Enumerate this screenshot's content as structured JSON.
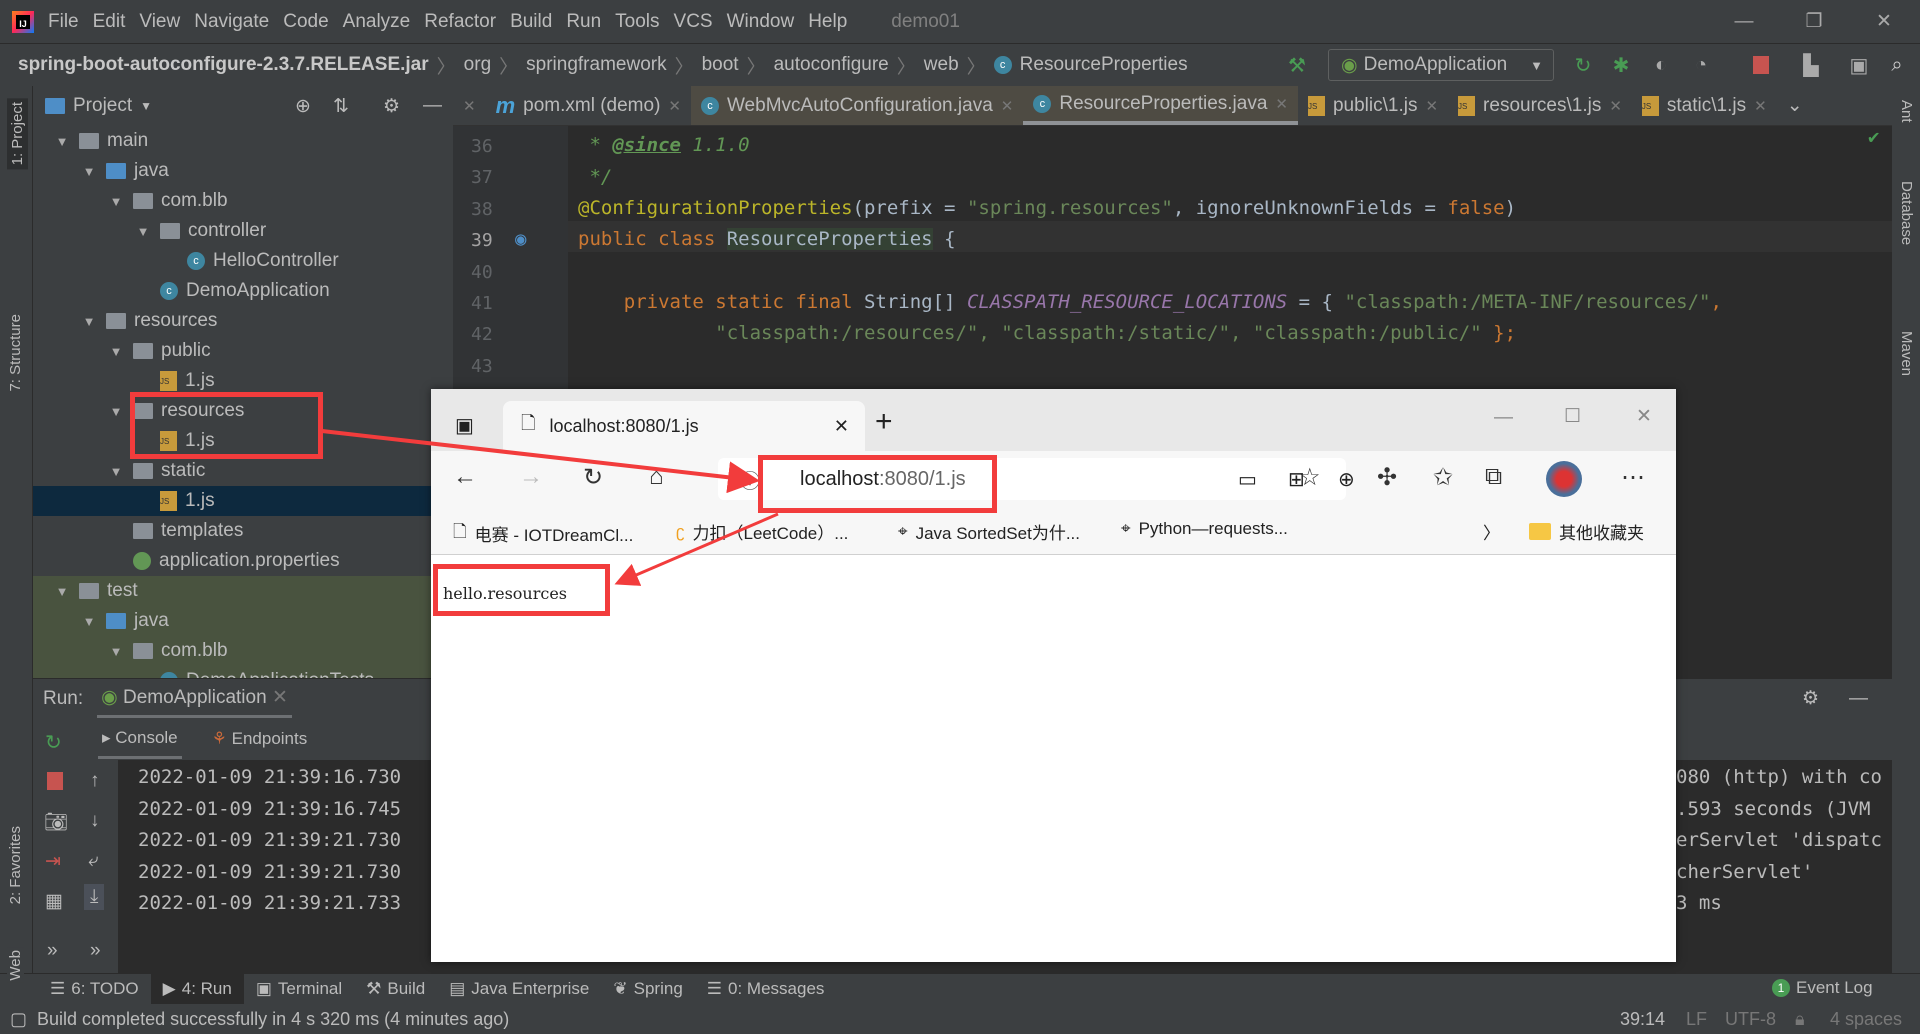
{
  "menu": {
    "items": [
      "File",
      "Edit",
      "View",
      "Navigate",
      "Code",
      "Analyze",
      "Refactor",
      "Build",
      "Run",
      "Tools",
      "VCS",
      "Window",
      "Help"
    ],
    "project_title": "demo01"
  },
  "breadcrumb": [
    "spring-boot-autoconfigure-2.3.7.RELEASE.jar",
    "org",
    "springframework",
    "boot",
    "autoconfigure",
    "web",
    "ResourceProperties"
  ],
  "run_config": "DemoApplication",
  "project_panel": {
    "title": "Project",
    "tree": [
      {
        "label": "main",
        "level": 0,
        "type": "folder",
        "open": true
      },
      {
        "label": "java",
        "level": 1,
        "type": "src",
        "open": true
      },
      {
        "label": "com.blb",
        "level": 2,
        "type": "pkg",
        "open": true
      },
      {
        "label": "controller",
        "level": 3,
        "type": "pkg",
        "open": true
      },
      {
        "label": "HelloController",
        "level": 4,
        "type": "class"
      },
      {
        "label": "DemoApplication",
        "level": 3,
        "type": "class"
      },
      {
        "label": "resources",
        "level": 1,
        "type": "res",
        "open": true
      },
      {
        "label": "public",
        "level": 2,
        "type": "folder",
        "open": true
      },
      {
        "label": "1.js",
        "level": 3,
        "type": "js"
      },
      {
        "label": "resources",
        "level": 2,
        "type": "folder",
        "open": true
      },
      {
        "label": "1.js",
        "level": 3,
        "type": "js"
      },
      {
        "label": "static",
        "level": 2,
        "type": "folder",
        "open": true
      },
      {
        "label": "1.js",
        "level": 3,
        "type": "js",
        "selected": true
      },
      {
        "label": "templates",
        "level": 2,
        "type": "folder"
      },
      {
        "label": "application.properties",
        "level": 2,
        "type": "props"
      },
      {
        "label": "test",
        "level": 0,
        "type": "folder",
        "open": true,
        "test": true
      },
      {
        "label": "java",
        "level": 1,
        "type": "src",
        "open": true,
        "test": true
      },
      {
        "label": "com.blb",
        "level": 2,
        "type": "pkg",
        "open": true,
        "test": true
      },
      {
        "label": "DemoApplicationTests",
        "level": 3,
        "type": "class",
        "test": true
      }
    ]
  },
  "editor_tabs": [
    {
      "label": "pom.xml (demo)",
      "icon": "maven"
    },
    {
      "label": "WebMvcAutoConfiguration.java",
      "icon": "class"
    },
    {
      "label": "ResourceProperties.java",
      "icon": "class",
      "active": true
    },
    {
      "label": "public\\1.js",
      "icon": "js"
    },
    {
      "label": "resources\\1.js",
      "icon": "js"
    },
    {
      "label": "static\\1.js",
      "icon": "js"
    }
  ],
  "code": {
    "line_numbers": [
      "36",
      "37",
      "38",
      "39",
      "40",
      "41",
      "42",
      "43"
    ],
    "l36_a": " * ",
    "l36_tag": "@since",
    "l36_b": " 1.1.0",
    "l37": " */",
    "l38_ann": "@ConfigurationProperties",
    "l38_a": "(prefix = ",
    "l38_str": "\"spring.resources\"",
    "l38_b": ", ignoreUnknownFields = ",
    "l38_false": "false",
    "l38_c": ")",
    "l39_kw": "public class ",
    "l39_name": "ResourceProperties",
    "l39_b": " {",
    "l41_kw": "    private static final ",
    "l41_type": "String[] ",
    "l41_const": "CLASSPATH_RESOURCE_LOCATIONS",
    "l41_eq": " = { ",
    "l41_str": "\"classpath:/META-INF/resources/\"",
    "l41_comma": ",",
    "l42_str": "            \"classpath:/resources/\", \"classpath:/static/\", \"classpath:/public/\"",
    "l42_end": " };"
  },
  "side_tools": {
    "left": [
      "1: Project",
      "7: Structure",
      "2: Favorites",
      "Web"
    ],
    "right": [
      "Ant",
      "Database",
      "Maven"
    ]
  },
  "run_panel": {
    "label": "Run:",
    "config": "DemoApplication",
    "tabs": [
      "Console",
      "Endpoints"
    ],
    "lines": [
      {
        "time": "2022-01-09 21:39:16.730",
        "tail": "080 (http) with co"
      },
      {
        "time": "2022-01-09 21:39:16.745",
        "tail": ".593 seconds (JVM"
      },
      {
        "time": "2022-01-09 21:39:21.730",
        "tail": "erServlet 'dispatc"
      },
      {
        "time": "2022-01-09 21:39:21.730",
        "tail": "cherServlet'"
      },
      {
        "time": "2022-01-09 21:39:21.733",
        "tail": "3 ms"
      }
    ]
  },
  "bottom_tools": [
    "6: TODO",
    "4: Run",
    "Terminal",
    "Build",
    "Java Enterprise",
    "Spring",
    "0: Messages"
  ],
  "event_log": {
    "label": "Event Log",
    "count": "1"
  },
  "status": {
    "message": "Build completed successfully in 4 s 320 ms (4 minutes ago)",
    "position": "39:14",
    "line_sep": "LF",
    "encoding": "UTF-8",
    "indent": "4 spaces"
  },
  "browser": {
    "tab_title": "localhost:8080/1.js",
    "url_host": "localhost",
    "url_rest": ":8080/1.js",
    "bookmarks": [
      "电赛 - IOTDreamCl...",
      "力扣（LeetCode）...",
      "Java SortedSet为什...",
      "Python—requests..."
    ],
    "other_bookmarks": "其他收藏夹",
    "content": "hello.resources"
  },
  "colors": {
    "annotation_red": "#f23c3c",
    "ide_bg": "#2b2b2b",
    "panel_bg": "#3c3f41"
  }
}
